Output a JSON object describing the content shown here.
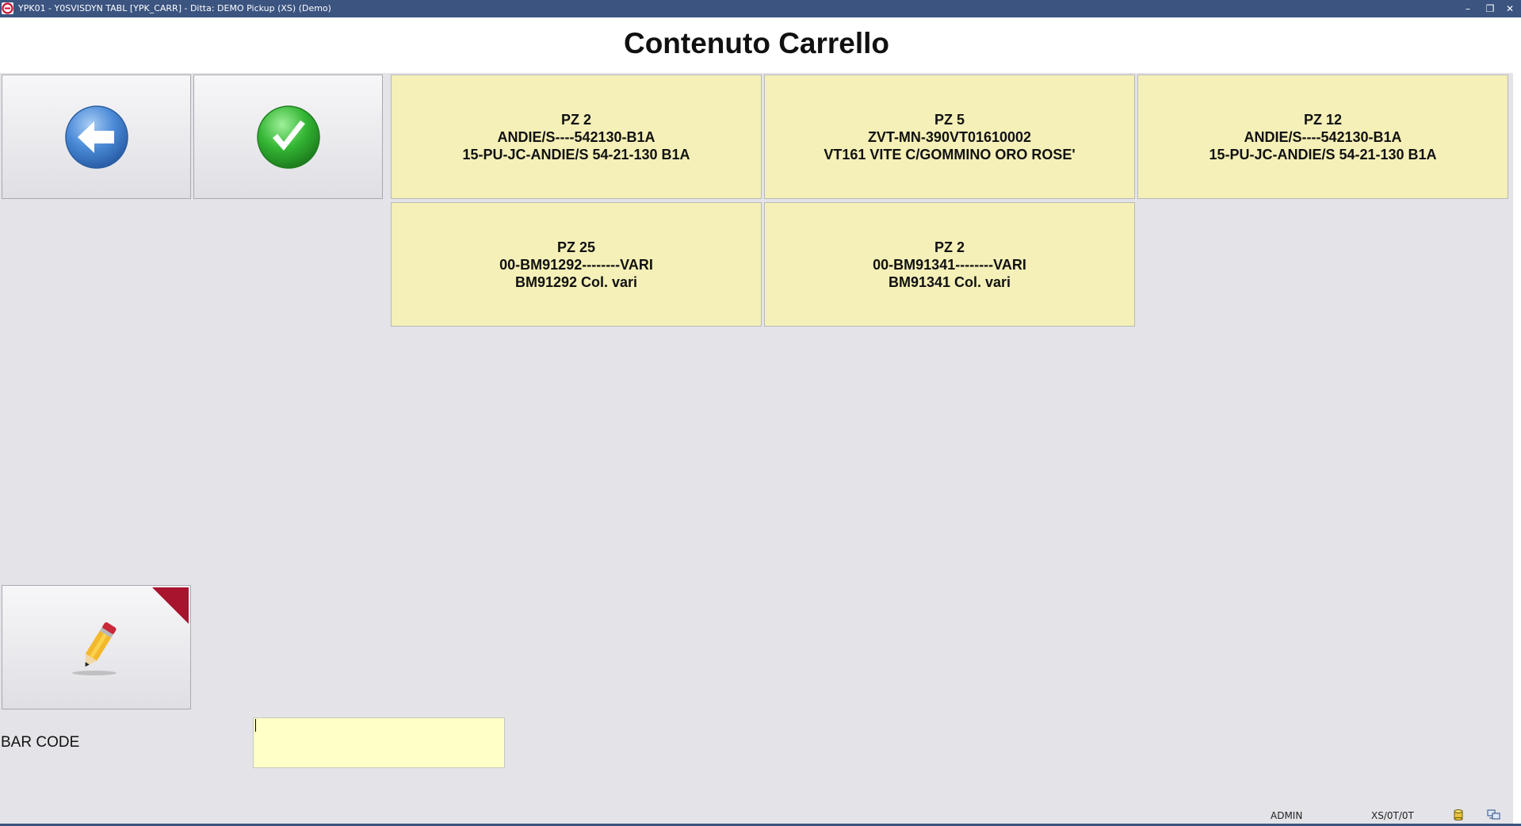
{
  "window": {
    "title": "YPK01 - Y0SVISDYN TABL [YPK_CARR] - Ditta: DEMO Pickup (XS)  (Demo)",
    "minimize": "–",
    "restore": "❐",
    "close": "✕"
  },
  "page": {
    "title": "Contenuto Carrello"
  },
  "items": [
    {
      "line1": "PZ 2",
      "line2": "ANDIE/S----542130-B1A",
      "line3": "15-PU-JC-ANDIE/S 54-21-130 B1A"
    },
    {
      "line1": "PZ 5",
      "line2": "ZVT-MN-390VT01610002",
      "line3": "VT161 VITE C/GOMMINO ORO ROSE'"
    },
    {
      "line1": "PZ 12",
      "line2": "ANDIE/S----542130-B1A",
      "line3": "15-PU-JC-ANDIE/S 54-21-130 B1A"
    },
    {
      "line1": "PZ 25",
      "line2": "00-BM91292--------VARI",
      "line3": "BM91292 Col. vari"
    },
    {
      "line1": "PZ 2",
      "line2": "00-BM91341--------VARI",
      "line3": "BM91341 Col. vari"
    }
  ],
  "barcode": {
    "label": "BAR CODE",
    "value": ""
  },
  "status": {
    "user": "ADMIN",
    "code": "XS/0T/0T"
  },
  "colors": {
    "titlebar": "#3b5480",
    "tile": "#f4f0b8",
    "input": "#ffffc8",
    "back_icon": "#3d7fcf",
    "confirm_icon": "#2aa62a",
    "corner_flag": "#a8142e"
  },
  "icons": {
    "back": "arrow-left-circle",
    "confirm": "checkmark-circle",
    "edit": "pencil",
    "database": "database-cylinder",
    "network": "network-computers"
  }
}
